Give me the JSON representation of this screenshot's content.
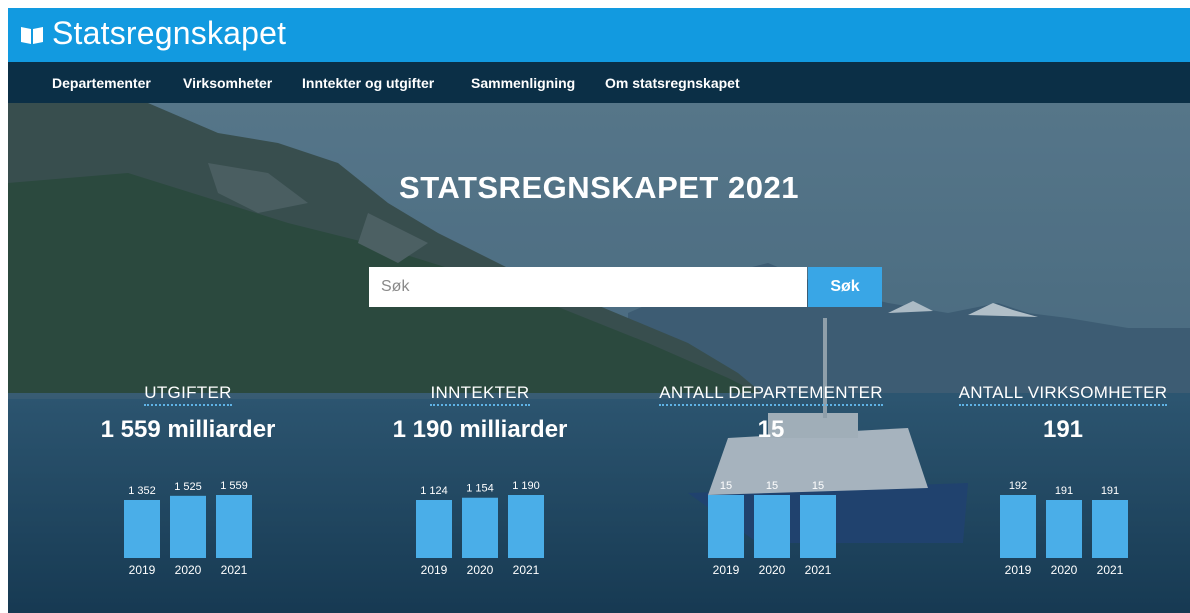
{
  "header": {
    "site_title": "Statsregnskapet",
    "logo_icon": "open-book-icon"
  },
  "nav": {
    "items": [
      "Departementer",
      "Virksomheter",
      "Inntekter og utgifter",
      "Sammenligning",
      "Om statsregnskapet"
    ]
  },
  "hero": {
    "title": "STATSREGNSKAPET 2021"
  },
  "search": {
    "placeholder": "Søk",
    "value": "",
    "button_label": "Søk"
  },
  "colors": {
    "header": "#129ae0",
    "nav": "#0b2f46",
    "bar": "#4aaee8",
    "button": "#39a6e6"
  },
  "stats": [
    {
      "label": "UTGIFTER",
      "value": "1 559 milliarder"
    },
    {
      "label": "INNTEKTER",
      "value": "1 190 milliarder"
    },
    {
      "label": "ANTALL DEPARTEMENTER",
      "value": "15"
    },
    {
      "label": "ANTALL VIRKSOMHETER",
      "value": "191"
    }
  ],
  "chart_data": [
    {
      "type": "bar",
      "categories": [
        "2019",
        "2020",
        "2021"
      ],
      "values": [
        1352,
        1525,
        1559
      ],
      "value_labels": [
        "1 352",
        "1 525",
        "1 559"
      ]
    },
    {
      "type": "bar",
      "categories": [
        "2019",
        "2020",
        "2021"
      ],
      "values": [
        1124,
        1154,
        1190
      ],
      "value_labels": [
        "1 124",
        "1 154",
        "1 190"
      ]
    },
    {
      "type": "bar",
      "categories": [
        "2019",
        "2020",
        "2021"
      ],
      "values": [
        15,
        15,
        15
      ],
      "value_labels": [
        "15",
        "15",
        "15"
      ]
    },
    {
      "type": "bar",
      "categories": [
        "2019",
        "2020",
        "2021"
      ],
      "values": [
        192,
        191,
        191
      ],
      "value_labels": [
        "192",
        "191",
        "191"
      ]
    }
  ]
}
